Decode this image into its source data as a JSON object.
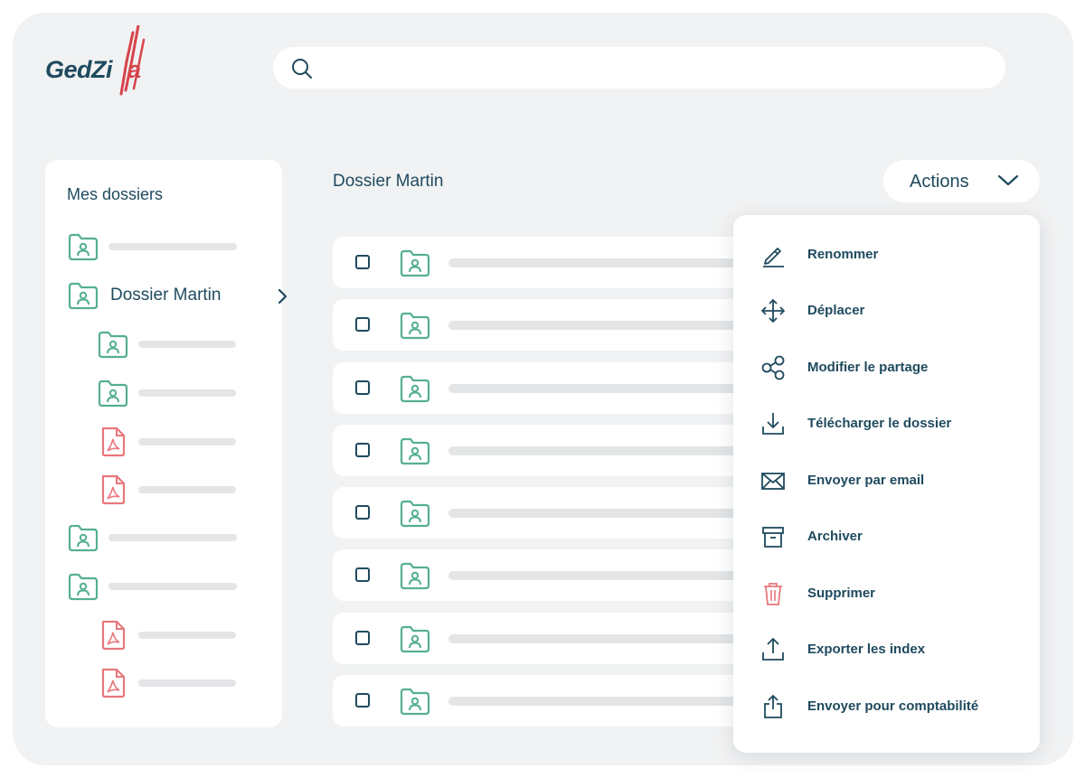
{
  "brand": {
    "name_part1": "Ged",
    "name_part2": "Zi",
    "name_part3": "a",
    "accent": "#d6434b",
    "primary": "#1f4a5e",
    "green": "#55b08e"
  },
  "search": {
    "placeholder": "",
    "icon": "search-icon"
  },
  "sidebar": {
    "title": "Mes dossiers",
    "items": [
      {
        "type": "folder",
        "label": "",
        "level": 0
      },
      {
        "type": "folder",
        "label": "Dossier Martin",
        "level": 0,
        "selected": true
      },
      {
        "type": "folder",
        "label": "",
        "level": 1
      },
      {
        "type": "folder",
        "label": "",
        "level": 1
      },
      {
        "type": "pdf",
        "label": "",
        "level": 1
      },
      {
        "type": "pdf",
        "label": "",
        "level": 1
      },
      {
        "type": "folder",
        "label": "",
        "level": 0
      },
      {
        "type": "folder",
        "label": "",
        "level": 0
      },
      {
        "type": "pdf",
        "label": "",
        "level": 1
      },
      {
        "type": "pdf",
        "label": "",
        "level": 1
      }
    ]
  },
  "main": {
    "title": "Dossier Martin",
    "actions_label": "Actions",
    "rows": [
      {
        "type": "folder"
      },
      {
        "type": "folder"
      },
      {
        "type": "folder"
      },
      {
        "type": "folder"
      },
      {
        "type": "folder"
      },
      {
        "type": "folder"
      },
      {
        "type": "folder"
      },
      {
        "type": "folder"
      }
    ]
  },
  "menu": {
    "items": [
      {
        "label": "Renommer",
        "icon": "pencil-icon"
      },
      {
        "label": "Déplacer",
        "icon": "move-icon"
      },
      {
        "label": "Modifier le partage",
        "icon": "share-icon"
      },
      {
        "label": "Télécharger le dossier",
        "icon": "download-icon"
      },
      {
        "label": "Envoyer par email",
        "icon": "email-icon"
      },
      {
        "label": "Archiver",
        "icon": "archive-icon"
      },
      {
        "label": "Supprimer",
        "icon": "trash-icon"
      },
      {
        "label": "Exporter les index",
        "icon": "upload-icon"
      },
      {
        "label": "Envoyer pour comptabilité",
        "icon": "export-icon"
      }
    ]
  }
}
